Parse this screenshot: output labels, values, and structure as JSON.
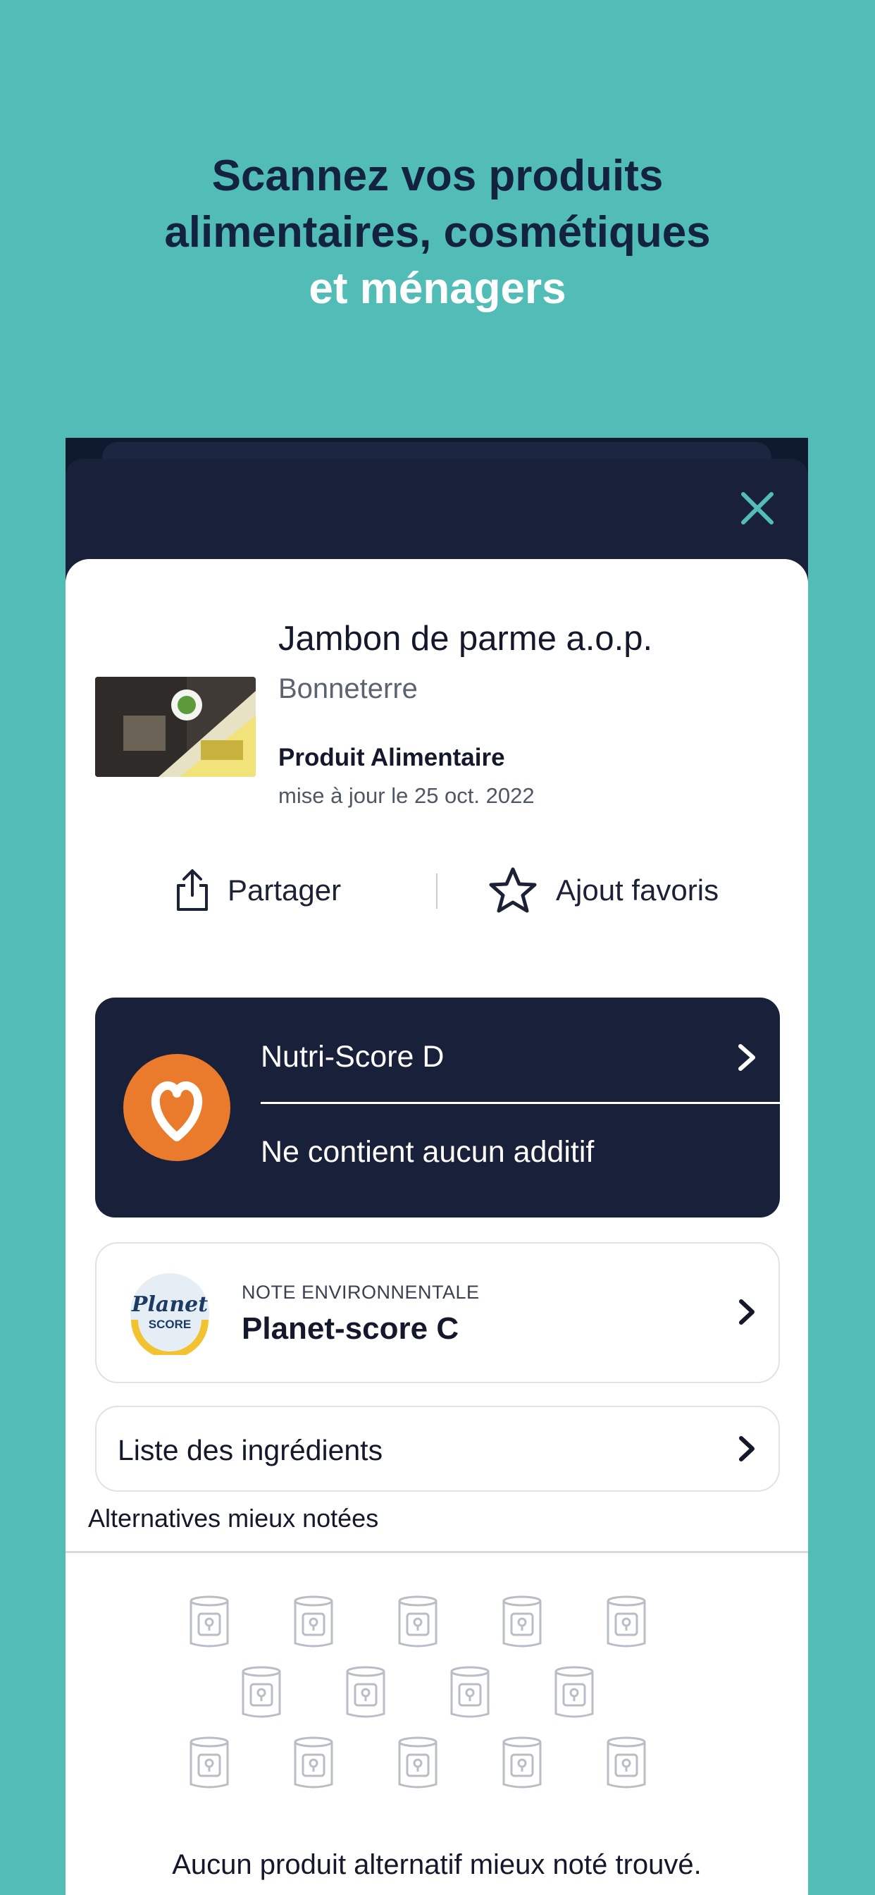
{
  "headline": {
    "line1": "Scannez vos produits",
    "line2": "alimentaires, cosmétiques",
    "line3": "et ménagers"
  },
  "product": {
    "name": "Jambon de parme a.o.p.",
    "brand": "Bonneterre",
    "type": "Produit Alimentaire",
    "updated": "mise à jour le 25 oct. 2022"
  },
  "actions": {
    "share_label": "Partager",
    "favorite_label": "Ajout favoris"
  },
  "nutri": {
    "score_label": "Nutri-Score D",
    "additives_label": "Ne contient aucun additif"
  },
  "planet": {
    "overline": "NOTE ENVIRONNENTALE",
    "score_label": "Planet-score C",
    "logo_word1": "Planet",
    "logo_word2": "SCORE"
  },
  "ingredients": {
    "label": "Liste des ingrédients"
  },
  "alternatives": {
    "title": "Alternatives mieux notées",
    "empty_message": "Aucun produit alternatif mieux noté trouvé."
  },
  "colors": {
    "background": "#52bdb6",
    "navy": "#19203a",
    "accent": "#52bdb6",
    "nutri_orange": "#ea7b2c"
  }
}
